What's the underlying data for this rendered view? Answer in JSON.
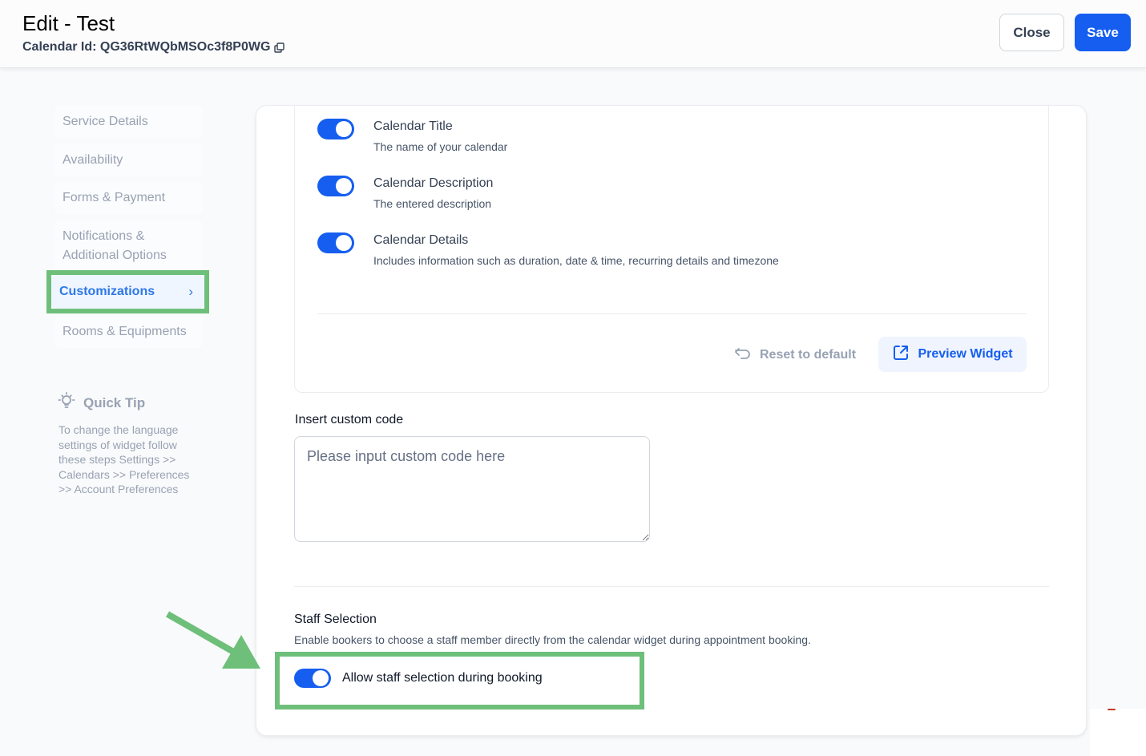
{
  "header": {
    "title": "Edit - Test",
    "calendar_id_label": "Calendar Id: QG36RtWQbMSOc3f8P0WG",
    "close_label": "Close",
    "save_label": "Save"
  },
  "sidebar": {
    "items": [
      {
        "label": "Service Details"
      },
      {
        "label": "Availability"
      },
      {
        "label": "Forms & Payment"
      },
      {
        "label": "Notifications & Additional Options"
      },
      {
        "label": "Customizations",
        "active": true
      },
      {
        "label": "Rooms & Equipments"
      }
    ],
    "active_chevron": "›",
    "quick_tip": {
      "title": "Quick Tip",
      "body": "To change the language settings of widget follow these steps Settings >> Calendars >> Preferences >> Account Preferences"
    }
  },
  "widget_options": [
    {
      "title": "Calendar Title",
      "description": "The name of your calendar",
      "enabled": true
    },
    {
      "title": "Calendar Description",
      "description": "The entered description",
      "enabled": true
    },
    {
      "title": "Calendar Details",
      "description": "Includes information such as duration, date & time, recurring details and timezone",
      "enabled": true
    }
  ],
  "actions": {
    "reset_label": "Reset to default",
    "preview_label": "Preview Widget"
  },
  "custom_code": {
    "label": "Insert custom code",
    "placeholder": "Please input custom code here",
    "value": ""
  },
  "staff_selection": {
    "title": "Staff Selection",
    "description": "Enable bookers to choose a staff member directly from the calendar widget during appointment booking.",
    "toggle_label": "Allow staff selection during booking",
    "enabled": true
  },
  "colors": {
    "primary": "#155eef",
    "highlight": "#6dbf7a",
    "active_nav": "#2e78e6"
  }
}
